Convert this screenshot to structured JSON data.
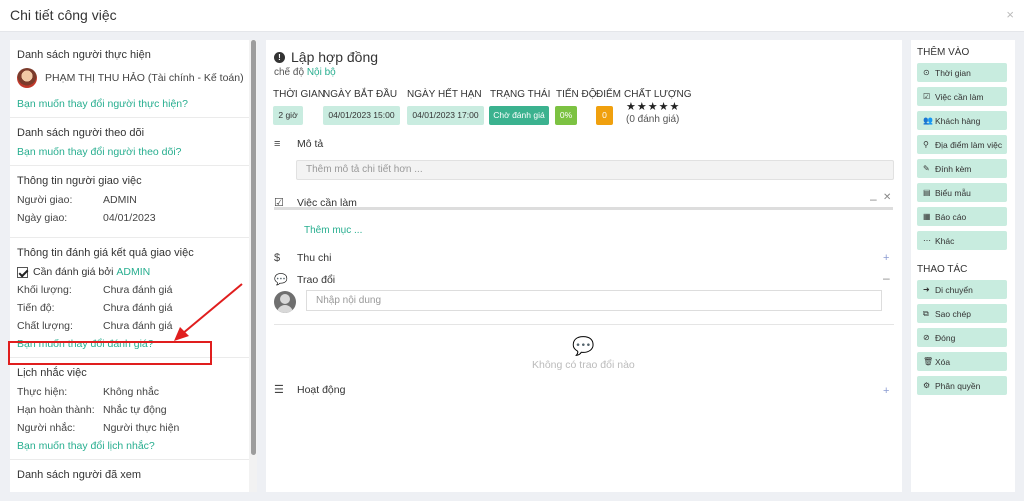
{
  "modal": {
    "title": "Chi tiết công việc",
    "close": "×"
  },
  "left": {
    "performers": {
      "title": "Danh sách người thực hiện",
      "person": "PHẠM THỊ THU HẢO (Tài chính - Kế toán)",
      "change": "Bạn muốn thay đổi người thực hiện?"
    },
    "followers": {
      "title": "Danh sách người theo dõi",
      "change": "Bạn muốn thay đổi người theo dõi?"
    },
    "assigner": {
      "title": "Thông tin người giao việc",
      "rows": [
        {
          "k": "Người giao:",
          "v": "ADMIN"
        },
        {
          "k": "Ngày giao:",
          "v": "04/01/2023"
        }
      ]
    },
    "evaluation": {
      "title": "Thông tin đánh giá kết quả giao việc",
      "check_label": "Cần đánh giá bởi",
      "check_by": "ADMIN",
      "rows": [
        {
          "k": "Khối lượng:",
          "v": "Chưa đánh giá"
        },
        {
          "k": "Tiến độ:",
          "v": "Chưa đánh giá"
        },
        {
          "k": "Chất lượng:",
          "v": "Chưa đánh giá"
        }
      ],
      "change": "Bạn muốn thay đổi đánh giá?"
    },
    "reminder": {
      "title": "Lịch nhắc việc",
      "rows": [
        {
          "k": "Thực hiện:",
          "v": "Không nhắc"
        },
        {
          "k": "Hạn hoàn thành:",
          "v": "Nhắc tự động"
        },
        {
          "k": "Người nhắc:",
          "v": "Người thực hiện"
        }
      ],
      "change": "Bạn muốn thay đổi lịch nhắc?"
    },
    "viewed": {
      "title": "Danh sách người đã xem"
    }
  },
  "task": {
    "title": "Lập hợp đồng",
    "mode_label": "chế độ",
    "mode_value": "Nội bộ",
    "headers": {
      "time": "THỜI GIAN",
      "start": "NGÀY BẮT ĐẦU",
      "end": "NGÀY HẾT HẠN",
      "status": "TRẠNG THÁI",
      "progress": "TIẾN ĐỘ",
      "score": "ĐIỂM",
      "quality": "CHẤT LƯỢNG"
    },
    "values": {
      "time": "2 giờ",
      "start": "04/01/2023 15:00",
      "end": "04/01/2023 17:00",
      "status": "Chờ đánh giá",
      "progress": "0%",
      "score": "0",
      "stars": "★★★★★",
      "rating_count": "(0 đánh giá)"
    },
    "colors": {
      "chip": "#c9ece0",
      "status": "#3bb28f",
      "progress": "#7cc242",
      "score": "#f0a00e"
    },
    "sections": {
      "desc": "Mô tả",
      "desc_placeholder": "Thêm mô tả chi tiết hơn ...",
      "todo": "Việc cần làm",
      "add_item": "Thêm mục ...",
      "expense": "Thu chi",
      "discussion": "Trao đổi",
      "comment_placeholder": "Nhập nội dung",
      "empty": "Không có trao đổi nào",
      "activity": "Hoạt động"
    }
  },
  "side": {
    "add_title": "THÊM VÀO",
    "add": [
      {
        "icon": "⊙",
        "label": "Thời gian"
      },
      {
        "icon": "☑",
        "label": "Việc cần làm"
      },
      {
        "icon": "👥",
        "label": "Khách hàng"
      },
      {
        "icon": "⚲",
        "label": "Địa điểm làm việc"
      },
      {
        "icon": "✎",
        "label": "Đính kèm"
      },
      {
        "icon": "▤",
        "label": "Biểu mẫu"
      },
      {
        "icon": "▦",
        "label": "Báo cáo"
      },
      {
        "icon": "⋯",
        "label": "Khác"
      }
    ],
    "actions_title": "THAO TÁC",
    "actions": [
      {
        "icon": "➜",
        "label": "Di chuyển"
      },
      {
        "icon": "⧉",
        "label": "Sao chép"
      },
      {
        "icon": "⊘",
        "label": "Đóng"
      },
      {
        "icon": "🗑",
        "label": "Xóa"
      },
      {
        "icon": "⚙",
        "label": "Phân quyền"
      }
    ]
  }
}
